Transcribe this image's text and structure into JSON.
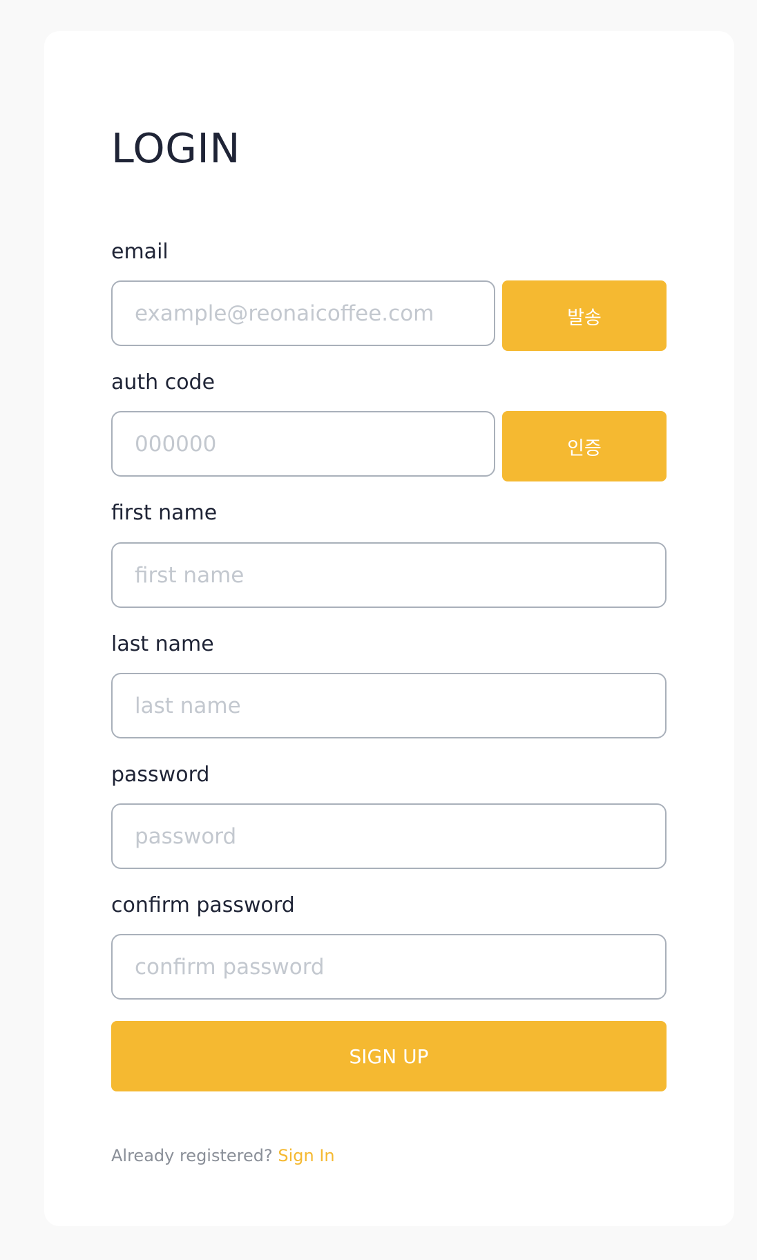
{
  "title": "LOGIN",
  "fields": {
    "email": {
      "label": "email",
      "placeholder": "example@reonaicoffee.com",
      "value": "",
      "button_label": "발송"
    },
    "auth_code": {
      "label": "auth code",
      "placeholder": "000000",
      "value": "",
      "button_label": "인증"
    },
    "first_name": {
      "label": "first name",
      "placeholder": "first name",
      "value": ""
    },
    "last_name": {
      "label": "last name",
      "placeholder": "last name",
      "value": ""
    },
    "password": {
      "label": "password",
      "placeholder": "password",
      "value": ""
    },
    "confirm_password": {
      "label": "confirm password",
      "placeholder": "confirm password",
      "value": ""
    }
  },
  "submit_label": "SIGN UP",
  "footer": {
    "prompt": "Already registered?",
    "link_label": "Sign In"
  },
  "colors": {
    "accent": "#f5b931",
    "text": "#1f2436",
    "placeholder": "#c3c8cf",
    "border": "#a9b0ba",
    "muted": "#8a8f98",
    "page_background": "#f9f9f9",
    "card_background": "#ffffff"
  }
}
